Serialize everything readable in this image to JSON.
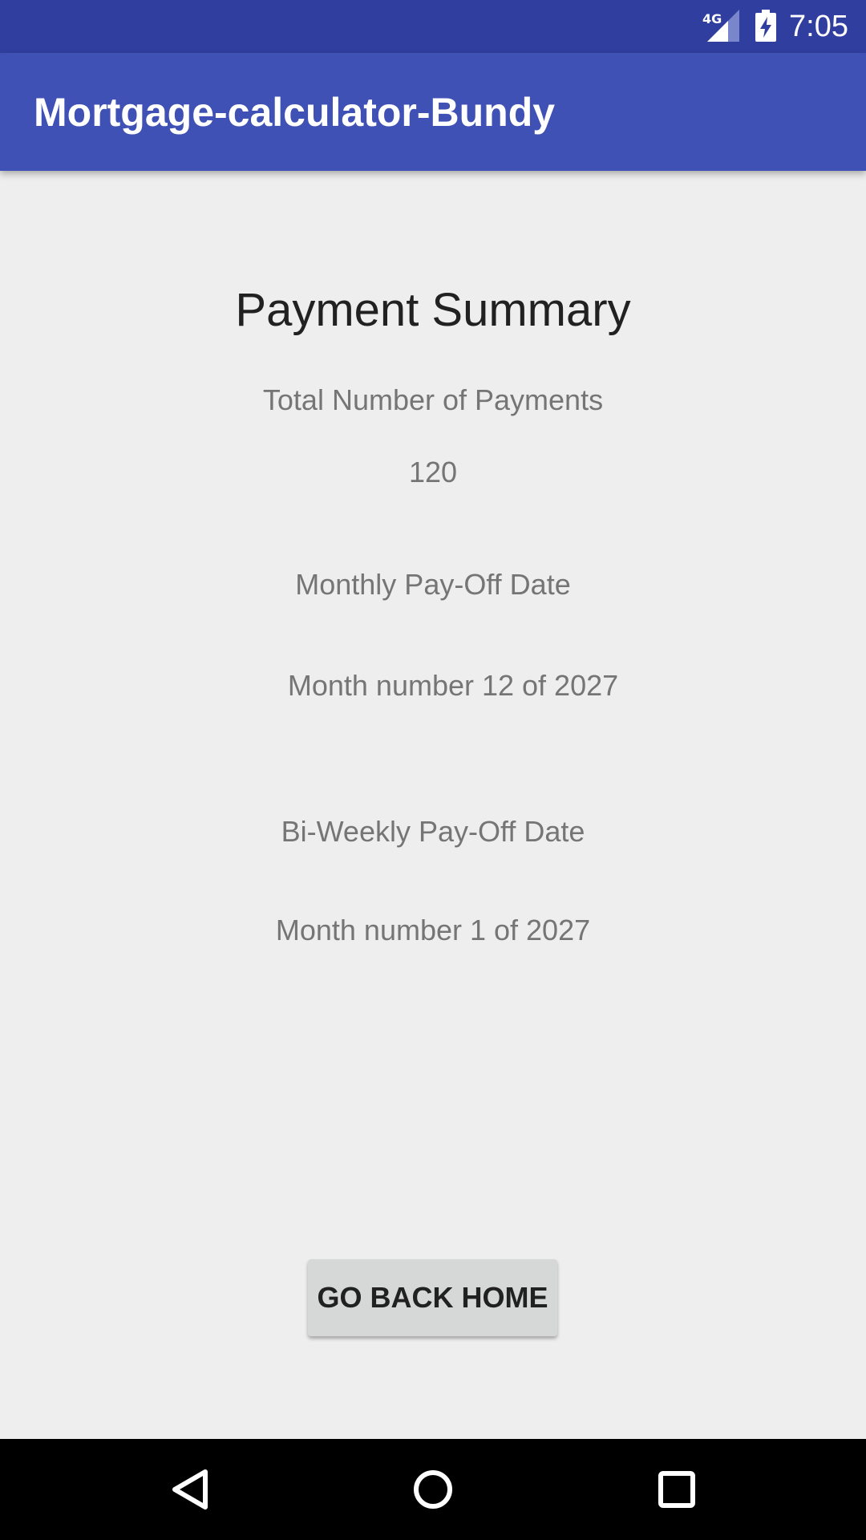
{
  "status_bar": {
    "network": "4G",
    "time": "7:05",
    "icons": [
      "signal-icon",
      "battery-charging-icon"
    ]
  },
  "app_bar": {
    "title": "Mortgage-calculator-Bundy",
    "color": "#3f51b5"
  },
  "summary": {
    "heading": "Payment Summary",
    "total_payments_label": "Total Number of Payments",
    "total_payments_value": "120",
    "monthly_payoff_label": "Monthly Pay-Off Date",
    "monthly_payoff_value": "Month number 12 of 2027",
    "biweekly_payoff_label": "Bi-Weekly Pay-Off Date",
    "biweekly_payoff_value": "Month number 1 of 2027"
  },
  "actions": {
    "go_back_home": "GO BACK HOME"
  },
  "nav_bar": {
    "icons": [
      "back-icon",
      "home-icon",
      "recents-icon"
    ]
  }
}
